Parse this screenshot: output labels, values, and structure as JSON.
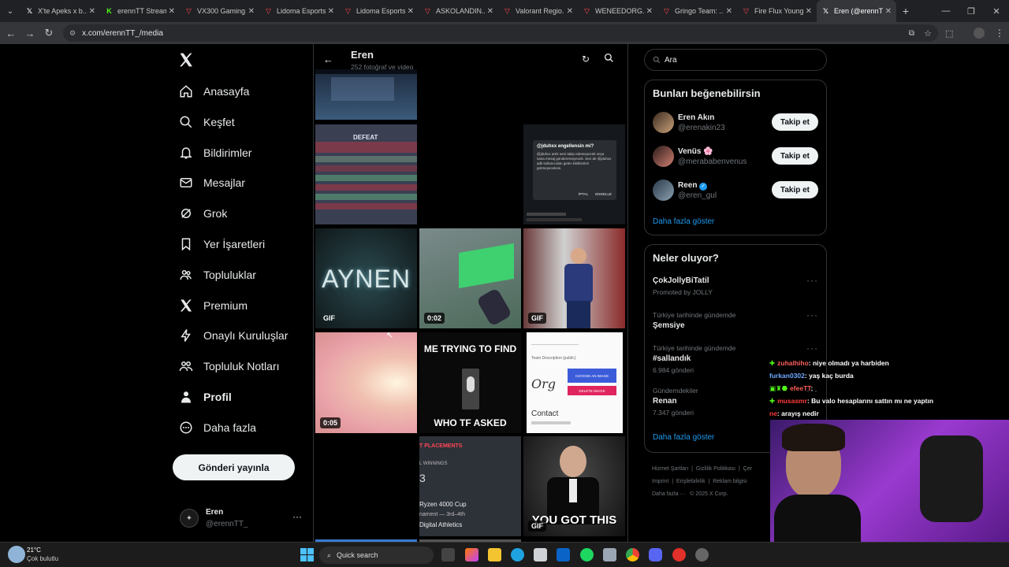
{
  "browser": {
    "tabs": [
      {
        "title": "X'te Apeks x b...",
        "icon": "x-logo-icon",
        "color": "#ffffff"
      },
      {
        "title": "erennTT Stream...",
        "icon": "kick-icon",
        "color": "#53fc18"
      },
      {
        "title": "VX300 Gaming...",
        "icon": "vlr-icon",
        "color": "#ff4655"
      },
      {
        "title": "Lidoma Esports...",
        "icon": "vlr-icon",
        "color": "#ff4655"
      },
      {
        "title": "Lidoma Esports...",
        "icon": "vlr-icon",
        "color": "#ff4655"
      },
      {
        "title": "ASKOLANDIN...",
        "icon": "vlr-icon",
        "color": "#ff4655"
      },
      {
        "title": "Valorant Regio...",
        "icon": "vlr-icon",
        "color": "#ff4655"
      },
      {
        "title": "WENEEDORG...",
        "icon": "vlr-icon",
        "color": "#ff4655"
      },
      {
        "title": "Gringo Team: ...",
        "icon": "vlr-icon",
        "color": "#ff4655"
      },
      {
        "title": "Fire Flux Young...",
        "icon": "vlr-icon",
        "color": "#ff4655"
      },
      {
        "title": "Eren (@erennT...",
        "icon": "x-logo-icon",
        "color": "#ffffff",
        "active": true
      }
    ],
    "url": "x.com/erennTT_/media"
  },
  "sidebar": {
    "nav": [
      {
        "label": "Anasayfa",
        "icon": "home-icon"
      },
      {
        "label": "Keşfet",
        "icon": "search-icon"
      },
      {
        "label": "Bildirimler",
        "icon": "bell-icon"
      },
      {
        "label": "Mesajlar",
        "icon": "mail-icon"
      },
      {
        "label": "Grok",
        "icon": "grok-icon"
      },
      {
        "label": "Yer İşaretleri",
        "icon": "bookmark-icon"
      },
      {
        "label": "Topluluklar",
        "icon": "communities-icon"
      },
      {
        "label": "Premium",
        "icon": "x-logo-icon"
      },
      {
        "label": "Onaylı Kuruluşlar",
        "icon": "lightning-icon"
      },
      {
        "label": "Topluluk Notları",
        "icon": "notes-icon"
      },
      {
        "label": "Profil",
        "icon": "person-icon",
        "active": true
      },
      {
        "label": "Daha fazla",
        "icon": "more-circle-icon"
      }
    ],
    "post_button": "Gönderi yayınla",
    "account": {
      "name": "Eren",
      "handle": "@erennTT_"
    }
  },
  "profile_header": {
    "name": "Eren",
    "subtitle": "252 fotoğraf ve video"
  },
  "media": {
    "tiles": [
      {
        "id": "t1",
        "text": ""
      },
      {
        "id": "t2",
        "text": "DEFEAT"
      },
      {
        "id": "t3",
        "dialog_title": "@jduhxx engellensin mi?",
        "dialog_body": "@jduhxx artık seni takip edemeyecek veya sana mesaj gönderemeyecek. Sen de @jduhxx adlı kullanıcıdan gelen bildirimleri görmeyeceksin.",
        "cancel": "İPTAL",
        "block": "ENGELLE"
      },
      {
        "id": "t4",
        "text": "AYNEN",
        "badge": "GIF"
      },
      {
        "id": "t5",
        "badge": "0:02"
      },
      {
        "id": "t6",
        "badge": "GIF"
      },
      {
        "id": "t7",
        "badge": "0:05"
      },
      {
        "id": "t8",
        "top": "ME TRYING TO FIND",
        "bottom": "WHO TF ASKED"
      },
      {
        "id": "t9",
        "label1": "Team Description (public)",
        "btn1": "CHOOSE AN IMAGE",
        "btn2": "DELETE IMAGE",
        "contact": "Contact"
      },
      {
        "id": "t10",
        "head": "T PLACEMENTS",
        "line1": "L WINNINGS",
        "num": "3",
        "line2": "Ryzen 4000 Cup",
        "line3": "nament — 3rd–4th",
        "line4": "Digital Athletics"
      },
      {
        "id": "t11",
        "text": "YOU GOT THIS",
        "badge": "GIF"
      }
    ]
  },
  "right": {
    "search_placeholder": "Ara",
    "wtf": {
      "title": "Bunları beğenebilirsin",
      "users": [
        {
          "name": "Eren Akın",
          "handle": "@erenakin23",
          "button": "Takip et"
        },
        {
          "name": "Venüs 🌸",
          "handle": "@merababenvenus",
          "button": "Takip et"
        },
        {
          "name": "Reen",
          "handle": "@eren_gul",
          "button": "Takip et",
          "verified": true
        }
      ],
      "show_more": "Daha fazla göster"
    },
    "trends": {
      "title": "Neler oluyor?",
      "items": [
        {
          "context": "",
          "name": "ÇokJollyBiTatil",
          "meta": "Promoted by JOLLY"
        },
        {
          "context": "Türkiye tarihinde gündemde",
          "name": "Şemsiye",
          "meta": ""
        },
        {
          "context": "Türkiye tarihinde gündemde",
          "name": "#sallandık",
          "meta": "6.984 gönderi"
        },
        {
          "context": "Gündemdekiler",
          "name": "Renan",
          "meta": "7.347 gönderi"
        }
      ],
      "show_more": "Daha fazla göster"
    },
    "footer": {
      "l1": "Hizmet Şartları",
      "l2": "Gizlilik Politikası",
      "l3": "Çer",
      "l4": "Imprint",
      "l5": "Erişilebilirlik",
      "l6": "Reklam bilgisi",
      "l7": "Daha fazla ···",
      "l8": "© 2025 X Corp."
    }
  },
  "stream_chat": [
    {
      "user": "zuhalhiho",
      "msg": ": niye olmadı ya harbiden",
      "color": "#ff5e5e",
      "badge": "✚"
    },
    {
      "user": "furkan0302",
      "msg": ": yaş kaç burda",
      "color": "#6fa8ff",
      "badge": ""
    },
    {
      "user": "efeeTT",
      "msg": ":",
      "color": "#ff5e5e",
      "badge": "▣♜⬣"
    },
    {
      "user": "musasmr",
      "msg": ": Bu valo hesaplarını sattın mı ne yaptın",
      "color": "#ff3b3b",
      "badge": "✚"
    },
    {
      "user": "ne",
      "msg": ": arayış nedir",
      "color": "#ff3b3b",
      "badge": ""
    }
  ],
  "taskbar": {
    "weather_temp": "21°C",
    "weather_desc": "Çok bulutlu",
    "search": "Quick search"
  }
}
